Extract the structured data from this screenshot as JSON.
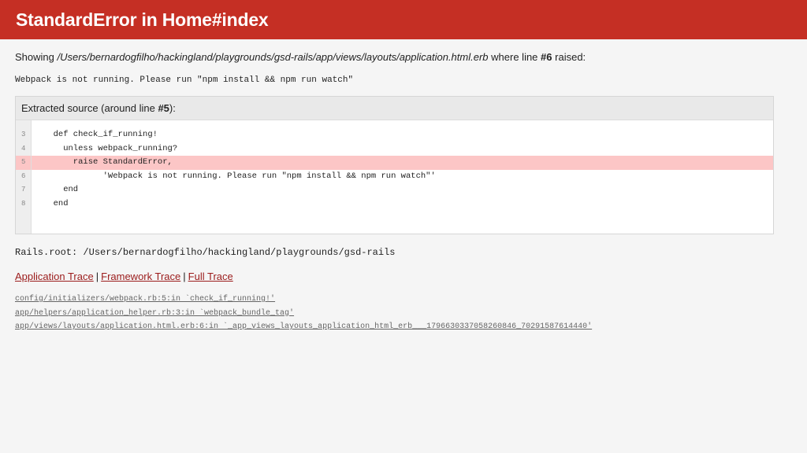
{
  "header": {
    "title": "StandardError in Home#index"
  },
  "showing": {
    "prefix": "Showing",
    "path": "/Users/bernardogfilho/hackingland/playgrounds/gsd-rails/app/views/layouts/application.html.erb",
    "middle": "where line",
    "line": "#6",
    "suffix": "raised:"
  },
  "message": "Webpack is not running. Please run \"npm install && npm run watch\"",
  "source": {
    "header_prefix": "Extracted source (around line",
    "header_line": "#5",
    "header_suffix": "):",
    "lines": [
      {
        "num": "3",
        "code": "  def check_if_running!"
      },
      {
        "num": "4",
        "code": "    unless webpack_running?"
      },
      {
        "num": "5",
        "code": "      raise StandardError,"
      },
      {
        "num": "6",
        "code": "            'Webpack is not running. Please run \"npm install && npm run watch\"'"
      },
      {
        "num": "7",
        "code": "    end"
      },
      {
        "num": "8",
        "code": "  end"
      }
    ],
    "highlighted_line": "5"
  },
  "rails_root": "Rails.root: /Users/bernardogfilho/hackingland/playgrounds/gsd-rails",
  "trace_links": {
    "application": "Application Trace",
    "framework": "Framework Trace",
    "full": "Full Trace",
    "separator": "|"
  },
  "trace": [
    "config/initializers/webpack.rb:5:in `check_if_running!'",
    "app/helpers/application_helper.rb:3:in `webpack_bundle_tag'",
    "app/views/layouts/application.html.erb:6:in `_app_views_layouts_application_html_erb___1796630337058260846_70291587614440'"
  ],
  "colors": {
    "header_bg": "#c52f24",
    "highlight": "#fcc6c6",
    "link": "#9b1b1b"
  }
}
